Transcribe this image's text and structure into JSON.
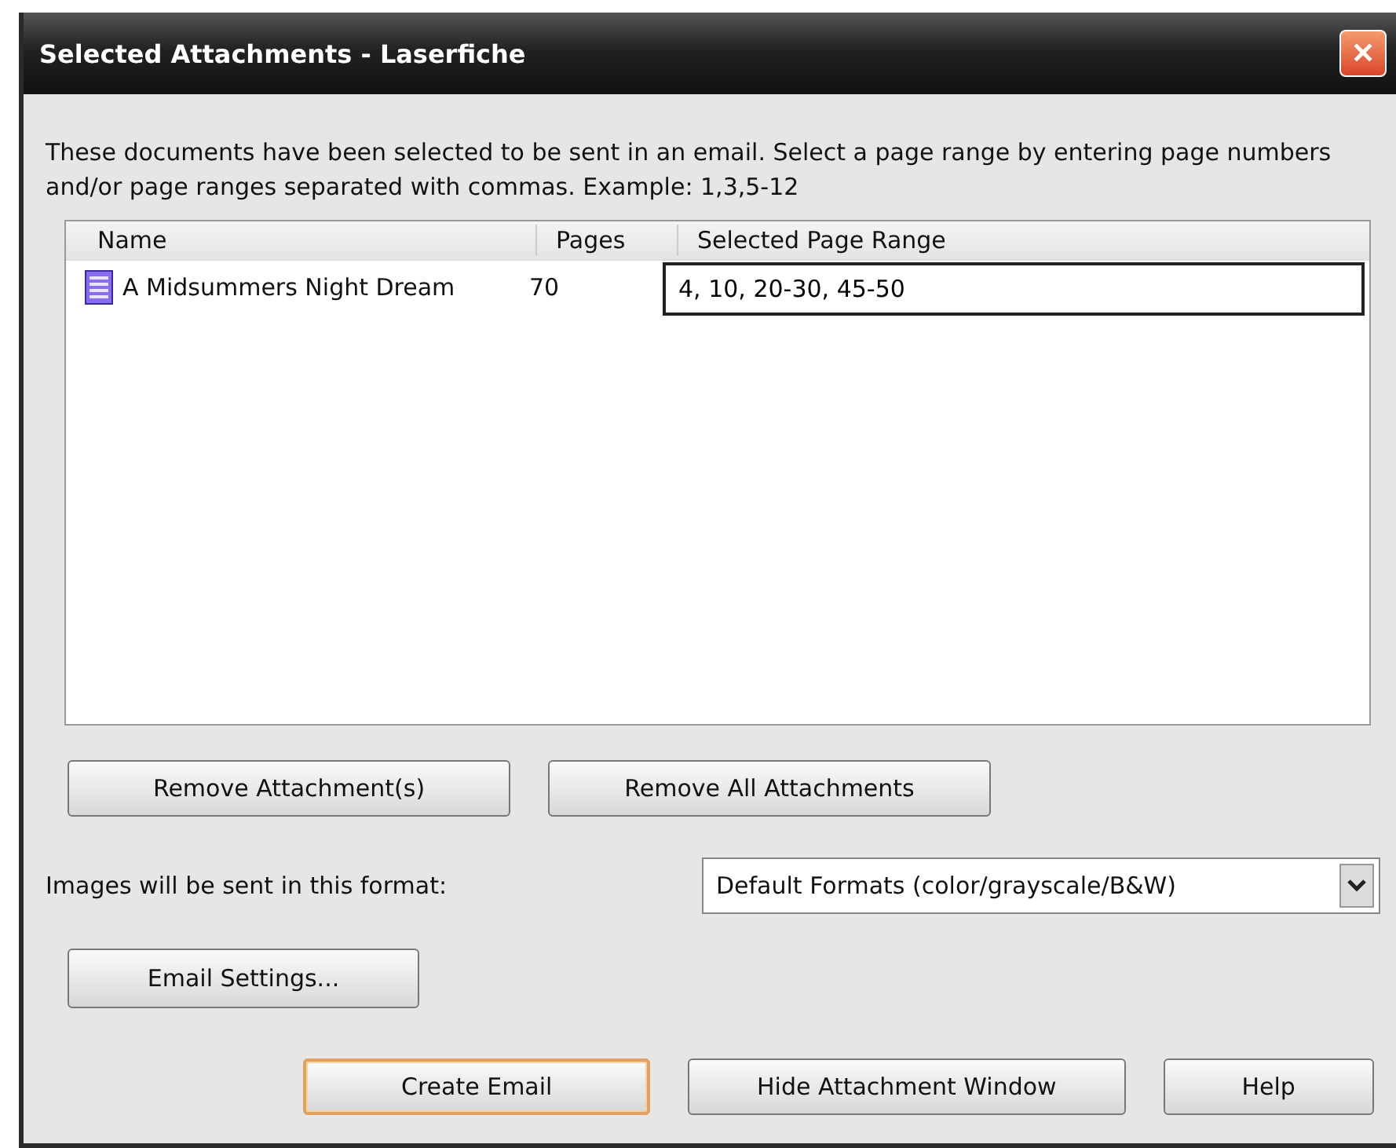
{
  "window": {
    "title": "Selected Attachments - Laserfiche",
    "close": "✕"
  },
  "intro": "These documents have been selected to be sent in an email. Select a page range by entering page numbers and/or page ranges separated with commas. Example: 1,3,5-12",
  "table": {
    "columns": [
      "Name",
      "Pages",
      "Selected Page Range"
    ],
    "rows": [
      {
        "name": "A Midsummers Night Dream",
        "pages": "70",
        "range": "4, 10, 20-30, 45-50"
      }
    ]
  },
  "remove_buttons": [
    "Remove Attachment(s)",
    "Remove All Attachments"
  ],
  "format": {
    "label": "Images will be sent in this format:",
    "value": "Default Formats (color/grayscale/B&W)"
  },
  "settings_button": "Email Settings...",
  "bottom_buttons": [
    {
      "label": "Create Email",
      "default": true
    },
    {
      "label": "Hide Attachment Window",
      "default": false
    },
    {
      "label": "Help",
      "default": false
    }
  ]
}
